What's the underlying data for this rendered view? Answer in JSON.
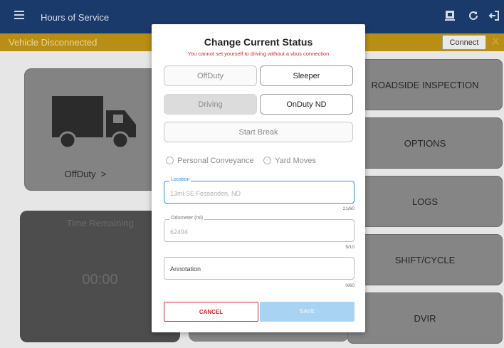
{
  "appbar": {
    "title": "Hours of Service",
    "actions": [
      "report-icon",
      "refresh-icon",
      "logout-icon"
    ]
  },
  "status_strip": {
    "text": "Vehicle Disconnected",
    "connect_label": "Connect",
    "close_label": "X"
  },
  "background": {
    "status_label": "OffDuty",
    "status_chevron": ">",
    "time_remaining_label": "Time Remaining",
    "time_remaining_value": "00:00",
    "menu_buttons": [
      "ROADSIDE INSPECTION",
      "OPTIONS",
      "LOGS",
      "SHIFT/CYCLE",
      "DVIR"
    ]
  },
  "dialog": {
    "title": "Change Current Status",
    "warning": "You cannot set yourself to driving without a vbus connection",
    "status_buttons": {
      "offduty": "OffDuty",
      "sleeper": "Sleeper",
      "driving": "Driving",
      "onduty_nd": "OnDuty ND",
      "start_break": "Start Break"
    },
    "radios": {
      "personal_conveyance": "Personal Conveyance",
      "yard_moves": "Yard Moves"
    },
    "location": {
      "label": "Location",
      "value": "13mi SE Fessenden, ND",
      "count": "21/60"
    },
    "odometer": {
      "label": "Odometer (mi)",
      "value": "62494",
      "count": "5/10"
    },
    "annotation": {
      "placeholder": "Annotation",
      "count": "0/60"
    },
    "cancel_label": "CANCEL",
    "save_label": "SAVE"
  },
  "colors": {
    "appbar": "#1a3a6b",
    "status_strip": "#b88f14",
    "accent_blue": "#2a8fe0",
    "danger_red": "#d9262b",
    "save_disabled": "#a9d3f3"
  }
}
